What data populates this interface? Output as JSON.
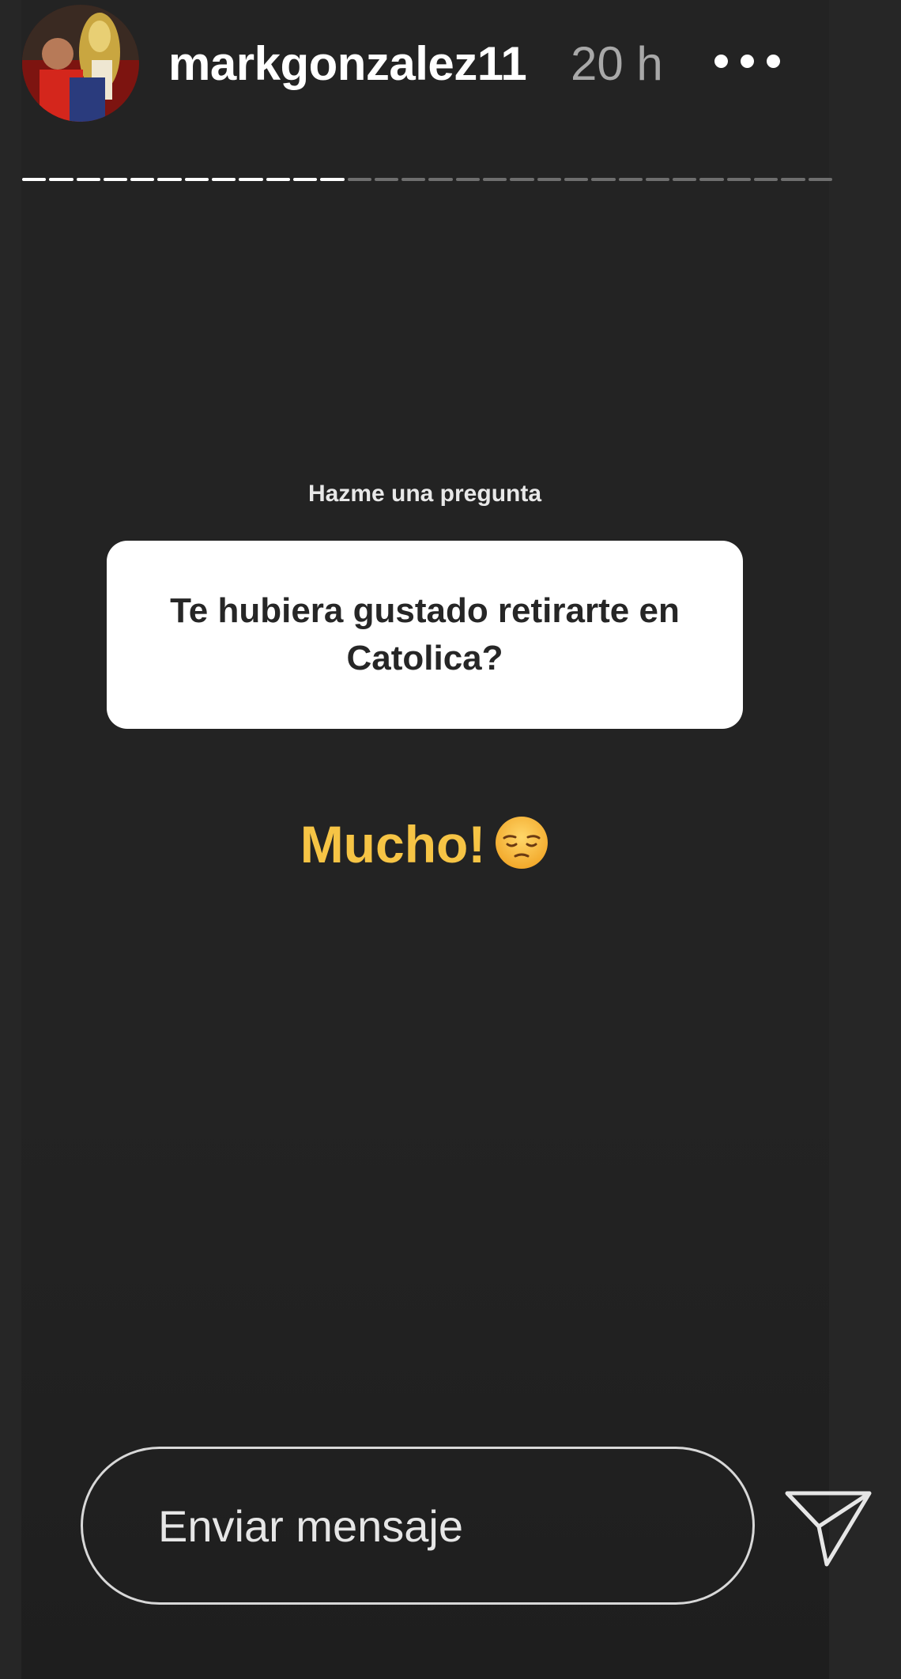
{
  "header": {
    "username": "markgonzalez11",
    "time": "20 h",
    "avatar_icon": "profile-photo",
    "more_icon": "more-dots-icon"
  },
  "progress": {
    "segments_total": 30,
    "segments_viewed": 12
  },
  "question_sticker": {
    "label": "Hazme una pregunta",
    "question": "Te hubiera gustado retirarte en Catolica?"
  },
  "answer": {
    "text": "Mucho!",
    "emoji": "pensive-face-emoji"
  },
  "reply": {
    "placeholder": "Enviar mensaje",
    "send_icon": "paper-plane-icon"
  },
  "colors": {
    "background": "#262626",
    "answer": "#f6c445",
    "card": "#ffffff"
  }
}
